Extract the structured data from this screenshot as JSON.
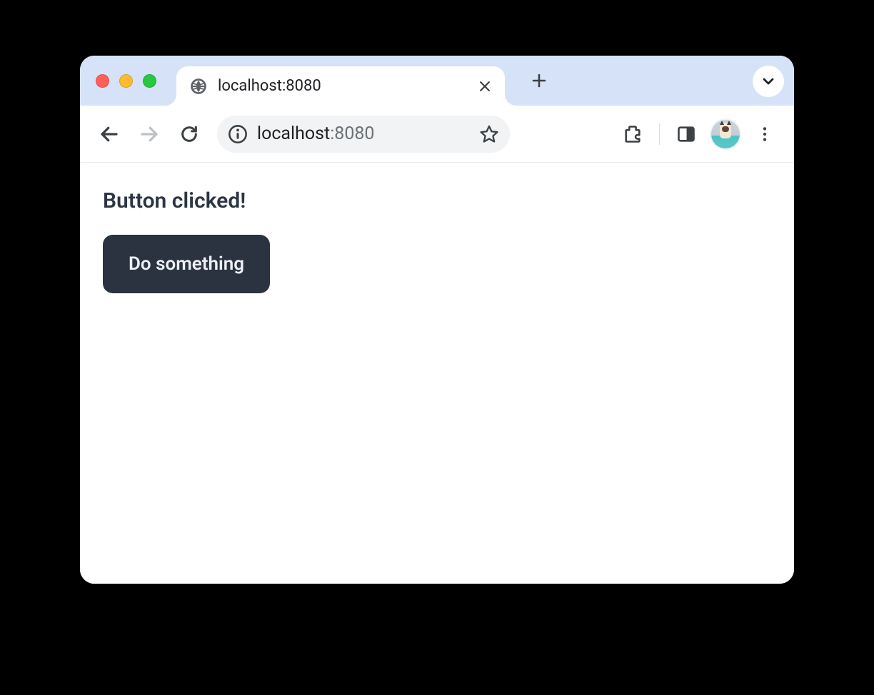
{
  "tab": {
    "title": "localhost:8080"
  },
  "omnibox": {
    "host": "localhost",
    "port": ":8080"
  },
  "page": {
    "message": "Button clicked!",
    "button_label": "Do something"
  }
}
